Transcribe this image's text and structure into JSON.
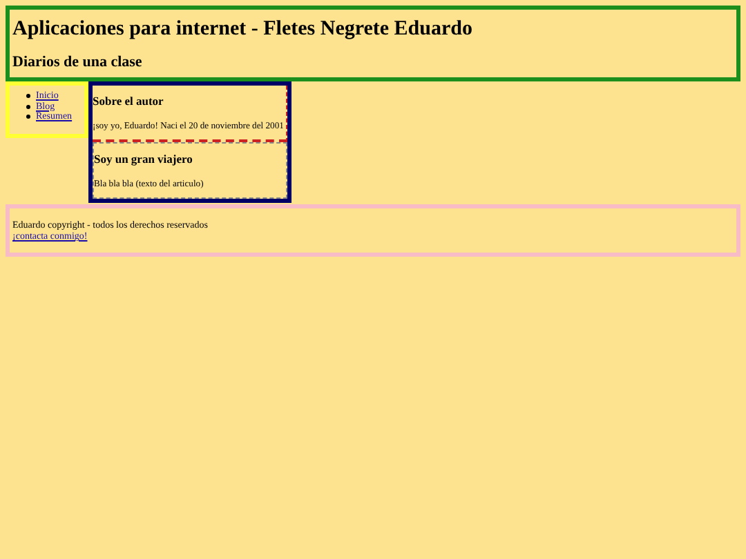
{
  "header": {
    "title": "Aplicaciones para internet - Fletes Negrete Eduardo",
    "subtitle": "Diarios de una clase"
  },
  "nav": {
    "items": [
      {
        "label": "Inicio"
      },
      {
        "label": "Blog"
      },
      {
        "label": "Resumen"
      }
    ]
  },
  "articles": [
    {
      "title": "Sobre el autor",
      "text": "¡soy yo, Eduardo! Naci el 20 de noviembre del 2001",
      "kind": "dashed-red"
    },
    {
      "title": "Soy un gran viajero",
      "text": "Bla bla bla (texto del articulo)",
      "kind": "plain"
    }
  ],
  "footer": {
    "text": "Eduardo copyright - todos los derechos reservados",
    "link": "¡contacta conmigo!"
  }
}
